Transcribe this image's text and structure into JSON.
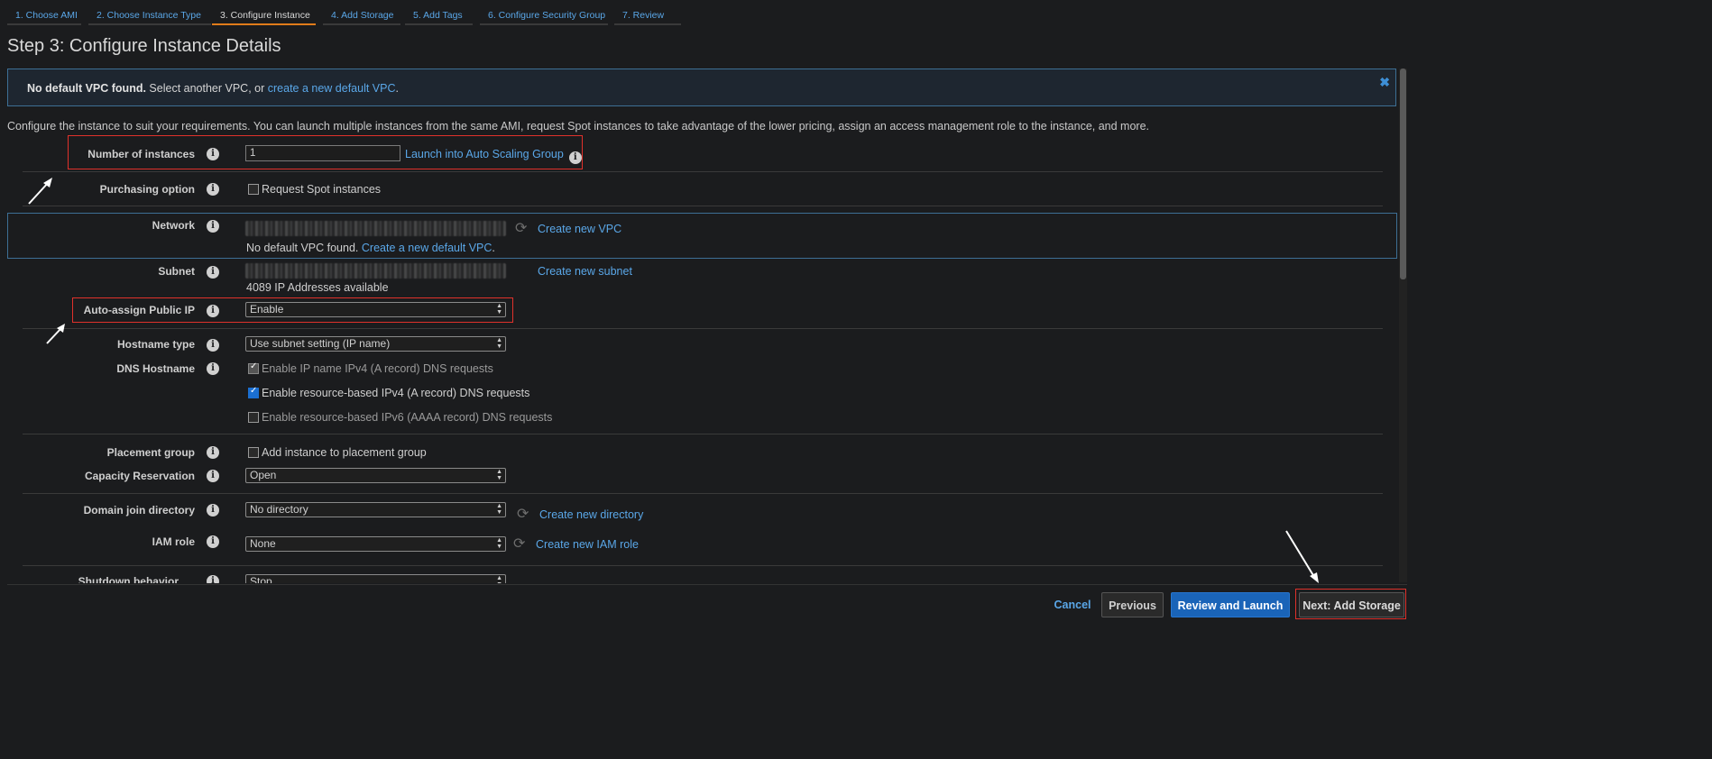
{
  "tabs": [
    {
      "label": "1. Choose AMI"
    },
    {
      "label": "2. Choose Instance Type"
    },
    {
      "label": "3. Configure Instance"
    },
    {
      "label": "4. Add Storage"
    },
    {
      "label": "5. Add Tags"
    },
    {
      "label": "6. Configure Security Group"
    },
    {
      "label": "7. Review"
    }
  ],
  "page_title": "Step 3: Configure Instance Details",
  "banner": {
    "bold": "No default VPC found.",
    "text": "Select another VPC, or",
    "link": "create a new default VPC",
    "suffix": ".",
    "close_glyph": "✖"
  },
  "intro": "Configure the instance to suit your requirements. You can launch multiple instances from the same AMI, request Spot instances to take advantage of the lower pricing, assign an access management role to the instance, and more.",
  "info_glyph": "i",
  "refresh_glyph": "⟳",
  "select_arrows": "▲\n▼",
  "fields": {
    "number_of_instances": {
      "label": "Number of instances",
      "value": "1",
      "link": "Launch into Auto Scaling Group"
    },
    "purchasing_option": {
      "label": "Purchasing option",
      "checkbox": "Request Spot instances"
    },
    "network": {
      "label": "Network",
      "link": "Create new VPC",
      "warning": "No default VPC found.",
      "warning_link": "Create a new default VPC",
      "warning_suffix": "."
    },
    "subnet": {
      "label": "Subnet",
      "link": "Create new subnet",
      "available": "4089 IP Addresses available"
    },
    "auto_assign_public_ip": {
      "label": "Auto-assign Public IP",
      "value": "Enable"
    },
    "hostname_type": {
      "label": "Hostname type",
      "value": "Use subnet setting (IP name)"
    },
    "dns_hostname": {
      "label": "DNS Hostname",
      "options": [
        {
          "label": "Enable IP name IPv4 (A record) DNS requests",
          "checked": true,
          "disabled": true
        },
        {
          "label": "Enable resource-based IPv4 (A record) DNS requests",
          "checked": true,
          "disabled": false
        },
        {
          "label": "Enable resource-based IPv6 (AAAA record) DNS requests",
          "checked": false,
          "disabled": true
        }
      ]
    },
    "placement_group": {
      "label": "Placement group",
      "checkbox": "Add instance to placement group"
    },
    "capacity_reservation": {
      "label": "Capacity Reservation",
      "value": "Open"
    },
    "domain_join_directory": {
      "label": "Domain join directory",
      "value": "No directory",
      "link": "Create new directory"
    },
    "iam_role": {
      "label": "IAM role",
      "value": "None",
      "link": "Create new IAM role"
    },
    "shutdown_behavior": {
      "label": "Shutdown behavior",
      "value": "Stop"
    }
  },
  "footer": {
    "cancel": "Cancel",
    "previous": "Previous",
    "review_and_launch": "Review and Launch",
    "next": "Next: Add Storage"
  },
  "colors": {
    "accent": "#e07b1a",
    "link": "#5aa7e8",
    "primary": "#1a64b8",
    "highlight": "#e0312b"
  }
}
